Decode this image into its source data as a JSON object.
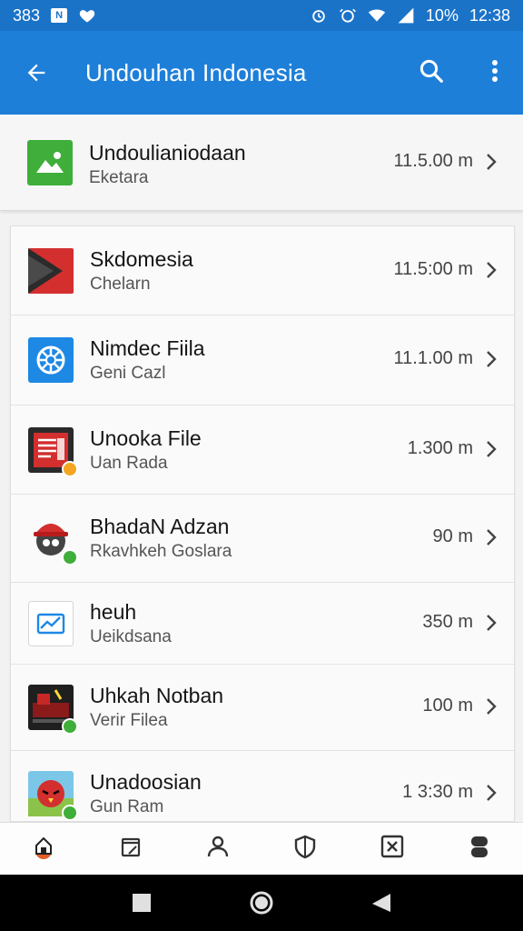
{
  "status_bar": {
    "time_left": "383",
    "time_right": "12:38",
    "battery": "10%",
    "notif_letter": "N"
  },
  "app_bar": {
    "title": "Undouhan Indonesia",
    "back_icon": "back-arrow-icon",
    "search_icon": "search-icon",
    "more_icon": "more-vert-icon"
  },
  "featured": {
    "name": "Undoulianiodaan",
    "sub": "Eketara",
    "size": "11.5.00 m",
    "icon": "image-icon",
    "color": "#3fae3a"
  },
  "items": [
    {
      "name": "Skdomesia",
      "sub": "Chelarn",
      "size": "11.5:00 m",
      "icon": "play-icon"
    },
    {
      "name": "Nimdec Fiila",
      "sub": "Geni Cazl",
      "size": "11.1.00 m",
      "icon": "aperture-icon"
    },
    {
      "name": "Unooka File",
      "sub": "Uan Rada",
      "size": "1.300 m",
      "icon": "document-icon"
    },
    {
      "name": "BhadaN Adzan",
      "sub": "Rkavhkeh Goslara",
      "size": "90 m",
      "icon": "mascot-icon"
    },
    {
      "name": "heuh",
      "sub": "Ueikdsana",
      "size": "350 m",
      "icon": "chart-icon"
    },
    {
      "name": "Uhkah Notban",
      "sub": "Verir Filea",
      "size": "100 m",
      "icon": "game-icon"
    },
    {
      "name": "Unadoosian",
      "sub": "Gun Ram",
      "size": "1 3:30 m",
      "icon": "bird-icon"
    }
  ],
  "bottom_nav": [
    {
      "name": "home",
      "icon": "home-icon"
    },
    {
      "name": "files",
      "icon": "files-icon"
    },
    {
      "name": "profile",
      "icon": "person-icon"
    },
    {
      "name": "shield",
      "icon": "shield-icon"
    },
    {
      "name": "close-box",
      "icon": "close-box-icon"
    },
    {
      "name": "storage",
      "icon": "storage-icon"
    }
  ],
  "colors": {
    "app_bar": "#1e7fd9",
    "status_bar": "#1b73c8",
    "accent_green": "#3fae3a",
    "accent_red": "#d32f2f",
    "accent_blue": "#1e88e5"
  }
}
